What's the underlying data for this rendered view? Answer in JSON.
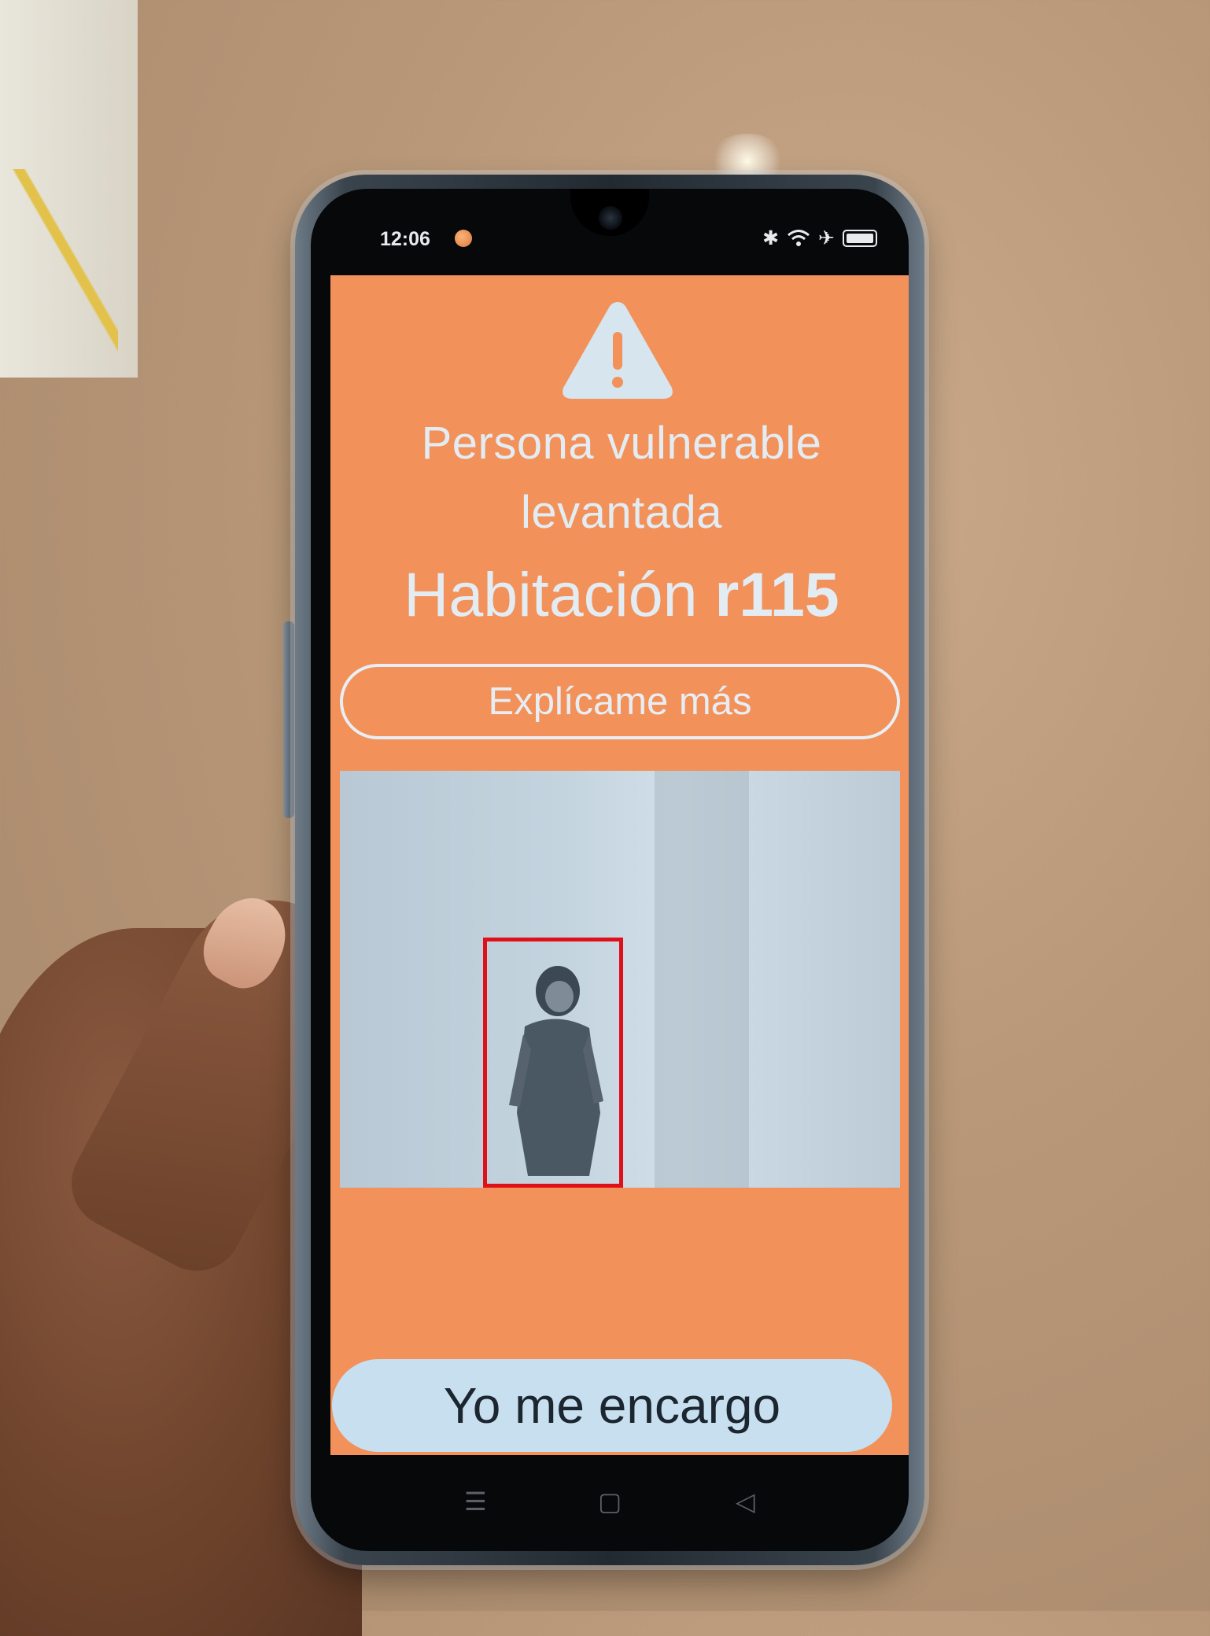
{
  "status_bar": {
    "time": "12:06",
    "icons": [
      "bluetooth-icon",
      "wifi-icon",
      "airplane-icon",
      "battery-icon"
    ]
  },
  "alert": {
    "icon": "warning-triangle-icon",
    "title_line1": "Persona vulnerable",
    "title_line2": "levantada",
    "room_label": "Habitación ",
    "room_id": "r115",
    "explain_button": "Explícame más",
    "action_button": "Yo me encargo",
    "background_color": "#f2915a",
    "text_color": "#e2ecf2",
    "detection_box_color": "#e01018"
  },
  "nav_bar": {
    "menu_glyph": "☰",
    "home_glyph": "▢",
    "back_glyph": "◁"
  }
}
